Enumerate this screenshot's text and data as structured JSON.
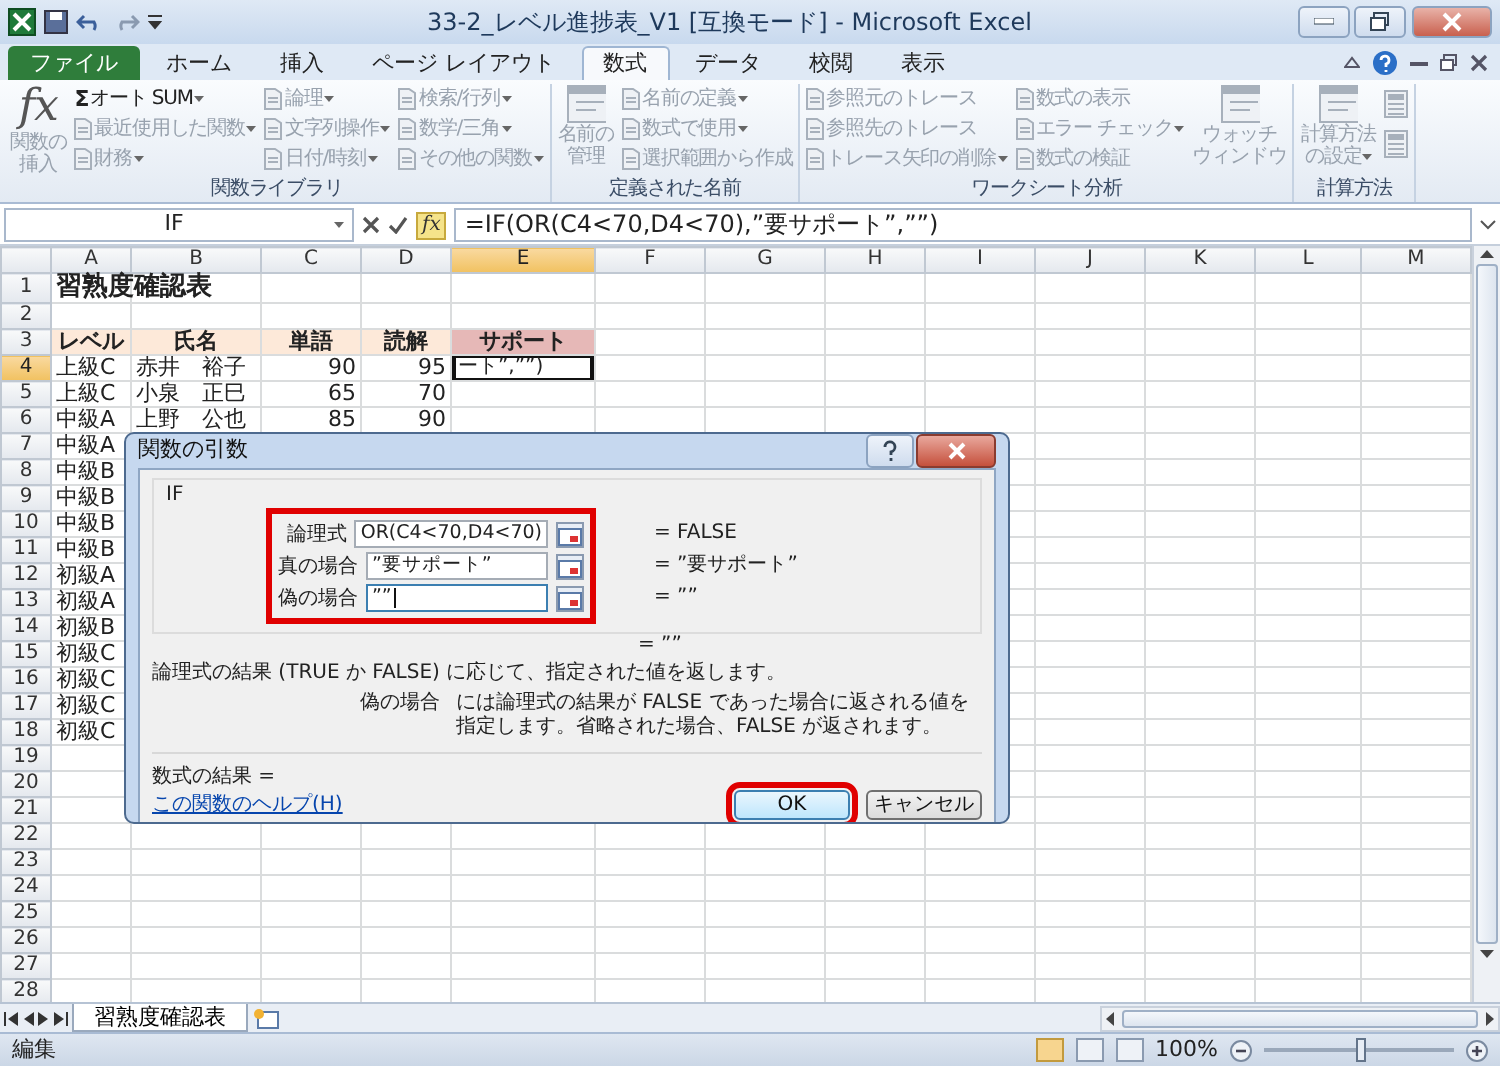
{
  "window": {
    "title": "33-2_レベル進捗表_V1 [互換モード] - Microsoft Excel"
  },
  "tabs": [
    {
      "label": "ファイル",
      "kind": "file",
      "selected": false
    },
    {
      "label": "ホーム",
      "kind": "tab",
      "selected": false
    },
    {
      "label": "挿入",
      "kind": "tab",
      "selected": false
    },
    {
      "label": "ページ レイアウト",
      "kind": "tab",
      "selected": false
    },
    {
      "label": "数式",
      "kind": "tab",
      "selected": true
    },
    {
      "label": "データ",
      "kind": "tab",
      "selected": false
    },
    {
      "label": "校閲",
      "kind": "tab",
      "selected": false
    },
    {
      "label": "表示",
      "kind": "tab",
      "selected": false
    }
  ],
  "ribbon": {
    "groups": [
      {
        "label": "関数ライブラリ",
        "columns": [
          [
            {
              "kind": "large",
              "lines": [
                "関数の",
                "挿入"
              ],
              "icon_text": "fx",
              "disabled": true
            }
          ],
          [
            {
              "kind": "small",
              "label": "オート SUM",
              "icon_text": "Σ",
              "dropdown": true,
              "disabled": false
            },
            {
              "kind": "small",
              "label": "最近使用した関数",
              "dropdown": true,
              "disabled": true
            },
            {
              "kind": "small",
              "label": "財務",
              "dropdown": true,
              "disabled": true
            }
          ],
          [
            {
              "kind": "small",
              "label": "論理",
              "dropdown": true,
              "disabled": true
            },
            {
              "kind": "small",
              "label": "文字列操作",
              "dropdown": true,
              "disabled": true
            },
            {
              "kind": "small",
              "label": "日付/時刻",
              "dropdown": true,
              "disabled": true
            }
          ],
          [
            {
              "kind": "small",
              "label": "検索/行列",
              "dropdown": true,
              "disabled": true
            },
            {
              "kind": "small",
              "label": "数学/三角",
              "dropdown": true,
              "disabled": true
            },
            {
              "kind": "small",
              "label": "その他の関数",
              "dropdown": true,
              "disabled": true
            }
          ]
        ]
      },
      {
        "label": "定義された名前",
        "columns": [
          [
            {
              "kind": "large",
              "lines": [
                "名前の",
                "管理"
              ],
              "disabled": true
            }
          ],
          [
            {
              "kind": "small",
              "label": "名前の定義",
              "dropdown": true,
              "disabled": true
            },
            {
              "kind": "small",
              "label": "数式で使用",
              "dropdown": true,
              "disabled": true
            },
            {
              "kind": "small",
              "label": "選択範囲から作成",
              "dropdown": false,
              "disabled": true
            }
          ]
        ]
      },
      {
        "label": "ワークシート分析",
        "columns": [
          [
            {
              "kind": "small",
              "label": "参照元のトレース",
              "dropdown": false,
              "disabled": true
            },
            {
              "kind": "small",
              "label": "参照先のトレース",
              "dropdown": false,
              "disabled": true
            },
            {
              "kind": "small",
              "label": "トレース矢印の削除",
              "dropdown": true,
              "disabled": true
            }
          ],
          [
            {
              "kind": "small",
              "label": "数式の表示",
              "dropdown": false,
              "disabled": true
            },
            {
              "kind": "small",
              "label": "エラー チェック",
              "dropdown": true,
              "disabled": true
            },
            {
              "kind": "small",
              "label": "数式の検証",
              "dropdown": false,
              "disabled": true
            }
          ],
          [
            {
              "kind": "large",
              "lines": [
                "ウォッチ",
                "ウィンドウ"
              ],
              "dropdown": false,
              "disabled": true
            }
          ]
        ]
      },
      {
        "label": "計算方法",
        "columns": [
          [
            {
              "kind": "large",
              "lines": [
                "計算方法",
                "の設定"
              ],
              "dropdown": true,
              "disabled": true
            }
          ],
          [
            {
              "kind": "icon",
              "disabled": true
            },
            {
              "kind": "icon",
              "disabled": true
            }
          ]
        ]
      }
    ]
  },
  "formula_bar": {
    "name_box": "IF",
    "function_button": "fx",
    "formula": "=IF(OR(C4<70,D4<70),”要サポート”,””)"
  },
  "sheet": {
    "columns": [
      {
        "label": "A",
        "selected": false
      },
      {
        "label": "B",
        "selected": false
      },
      {
        "label": "C",
        "selected": false
      },
      {
        "label": "D",
        "selected": false
      },
      {
        "label": "E",
        "selected": true
      },
      {
        "label": "F",
        "selected": false
      },
      {
        "label": "G",
        "selected": false
      },
      {
        "label": "H",
        "selected": false
      },
      {
        "label": "I",
        "selected": false
      },
      {
        "label": "J",
        "selected": false
      },
      {
        "label": "K",
        "selected": false
      },
      {
        "label": "L",
        "selected": false
      },
      {
        "label": "M",
        "selected": false
      }
    ],
    "rows": [
      {
        "header": "1",
        "selected": false,
        "cells": [
          {
            "kind": "title",
            "text": "習熟度確認表",
            "selected": false
          }
        ]
      },
      {
        "header": "2",
        "selected": false
      },
      {
        "header": "3",
        "selected": false,
        "cells": [
          {
            "kind": "heading",
            "text": "レベル",
            "color": "#fde9d9",
            "selected": false
          },
          {
            "kind": "heading",
            "text": "氏名",
            "color": "#fde9d9",
            "selected": false
          },
          {
            "kind": "heading",
            "text": "単語",
            "color": "#fde9d9",
            "selected": false
          },
          {
            "kind": "heading",
            "text": "読解",
            "color": "#fde9d9",
            "selected": false
          },
          {
            "kind": "heading",
            "text": "サポート",
            "color": "#e6b8b7",
            "selected": false
          }
        ]
      },
      {
        "header": "4",
        "selected": true,
        "cells": [
          {
            "kind": "text",
            "text": "上級C",
            "selected": false
          },
          {
            "kind": "text",
            "text": "赤井　裕子",
            "selected": false
          },
          {
            "kind": "number",
            "text": "90",
            "selected": false
          },
          {
            "kind": "number",
            "text": "95",
            "selected": false
          },
          {
            "kind": "text",
            "text": "ート”,””)",
            "selected": true
          }
        ]
      },
      {
        "header": "5",
        "selected": false,
        "cells": [
          {
            "kind": "text",
            "text": "上級C",
            "selected": false
          },
          {
            "kind": "text",
            "text": "小泉　正巳",
            "selected": false
          },
          {
            "kind": "number",
            "text": "65",
            "selected": false
          },
          {
            "kind": "number",
            "text": "70",
            "selected": false
          }
        ]
      },
      {
        "header": "6",
        "selected": false,
        "cells": [
          {
            "kind": "text",
            "text": "中級A",
            "selected": false
          },
          {
            "kind": "text",
            "text": "上野　公也",
            "selected": false
          },
          {
            "kind": "number",
            "text": "85",
            "selected": false
          },
          {
            "kind": "number",
            "text": "90",
            "selected": false
          }
        ]
      },
      {
        "header": "7",
        "selected": false,
        "cells": [
          {
            "kind": "text",
            "text": "中級A",
            "selected": false
          }
        ]
      },
      {
        "header": "8",
        "selected": false,
        "cells": [
          {
            "kind": "text",
            "text": "中級B",
            "selected": false
          }
        ]
      },
      {
        "header": "9",
        "selected": false,
        "cells": [
          {
            "kind": "text",
            "text": "中級B",
            "selected": false
          }
        ]
      },
      {
        "header": "10",
        "selected": false,
        "cells": [
          {
            "kind": "text",
            "text": "中級B",
            "selected": false
          }
        ]
      },
      {
        "header": "11",
        "selected": false,
        "cells": [
          {
            "kind": "text",
            "text": "中級B",
            "selected": false
          }
        ]
      },
      {
        "header": "12",
        "selected": false,
        "cells": [
          {
            "kind": "text",
            "text": "初級A",
            "selected": false
          }
        ]
      },
      {
        "header": "13",
        "selected": false,
        "cells": [
          {
            "kind": "text",
            "text": "初級A",
            "selected": false
          }
        ]
      },
      {
        "header": "14",
        "selected": false,
        "cells": [
          {
            "kind": "text",
            "text": "初級B",
            "selected": false
          }
        ]
      },
      {
        "header": "15",
        "selected": false,
        "cells": [
          {
            "kind": "text",
            "text": "初級C",
            "selected": false
          }
        ]
      },
      {
        "header": "16",
        "selected": false,
        "cells": [
          {
            "kind": "text",
            "text": "初級C",
            "selected": false
          }
        ]
      },
      {
        "header": "17",
        "selected": false,
        "cells": [
          {
            "kind": "text",
            "text": "初級C",
            "selected": false
          }
        ]
      },
      {
        "header": "18",
        "selected": false,
        "cells": [
          {
            "kind": "text",
            "text": "初級C",
            "selected": false
          }
        ]
      },
      {
        "header": "19",
        "selected": false
      },
      {
        "header": "20",
        "selected": false
      },
      {
        "header": "21",
        "selected": false
      },
      {
        "header": "22",
        "selected": false
      },
      {
        "header": "23",
        "selected": false
      },
      {
        "header": "24",
        "selected": false
      },
      {
        "header": "25",
        "selected": false
      },
      {
        "header": "26",
        "selected": false
      },
      {
        "header": "27",
        "selected": false
      },
      {
        "header": "28",
        "selected": false
      }
    ]
  },
  "sheet_tabs": [
    {
      "label": "習熟度確認表",
      "selected": true
    }
  ],
  "dialog": {
    "title": "関数の引数",
    "function_name": "IF",
    "arguments_highlighted": true,
    "arguments": [
      {
        "label": "論理式",
        "value": "OR(C4<70,D4<70)",
        "preview": "= FALSE",
        "focused": false
      },
      {
        "label": "真の場合",
        "value": "”要サポート”",
        "preview": "= ”要サポート”",
        "focused": false
      },
      {
        "label": "偽の場合",
        "value": "””",
        "preview": "= ””",
        "focused": true
      }
    ],
    "result_preview": "= ””",
    "description": "論理式の結果 (TRUE か FALSE) に応じて、指定された値を返します。",
    "argument_help_label": "偽の場合",
    "argument_help": "には論理式の結果が FALSE であった場合に返される値を指定します。省略された場合、FALSE が返されます。",
    "formula_result": "数式の結果 =",
    "help_link": "この関数のヘルプ(H)",
    "buttons": [
      {
        "label": "OK",
        "kind": "default",
        "highlighted": true
      },
      {
        "label": "キャンセル",
        "kind": "normal",
        "highlighted": false
      }
    ]
  },
  "status_bar": {
    "mode": "編集",
    "views": [
      {
        "selected": true
      },
      {
        "selected": false
      },
      {
        "selected": false
      }
    ],
    "zoom": {
      "reading": "100%",
      "level": 0.5
    }
  }
}
